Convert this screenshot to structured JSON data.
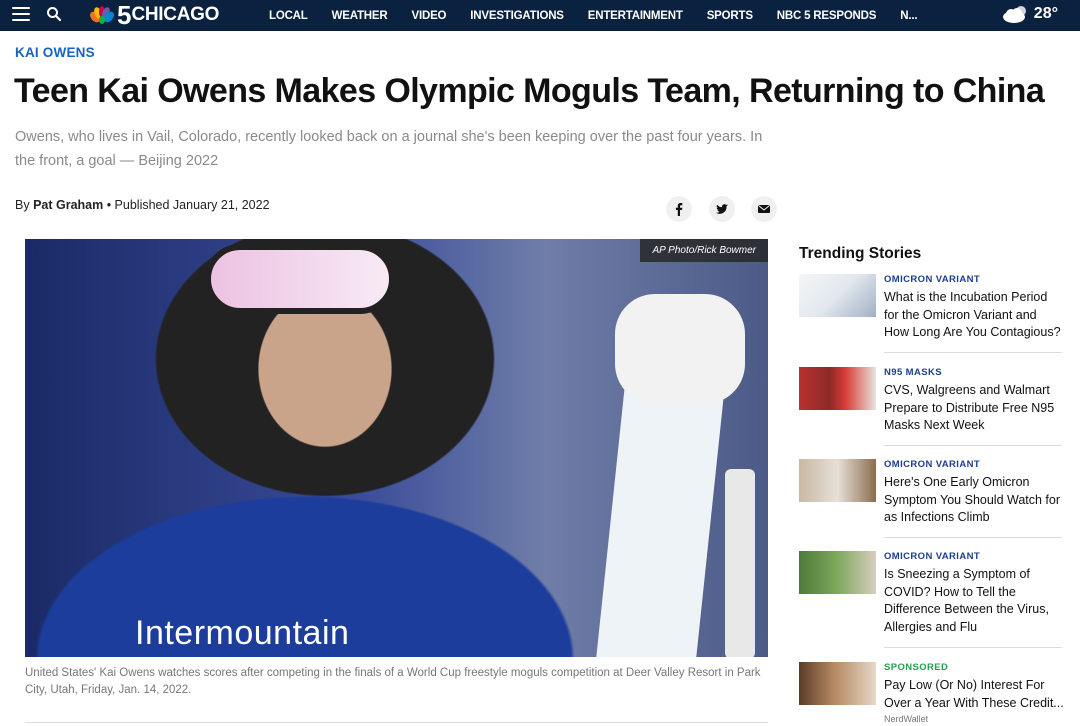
{
  "nav": {
    "logo_number": "5",
    "logo_city": "CHICAGO",
    "links": [
      "LOCAL",
      "WEATHER",
      "VIDEO",
      "INVESTIGATIONS",
      "ENTERTAINMENT",
      "SPORTS",
      "NBC 5 RESPONDS",
      "N..."
    ],
    "temperature": "28°",
    "weather_icon": "cloud-sun-icon"
  },
  "article": {
    "eyebrow": "KAI OWENS",
    "headline": "Teen Kai Owens Makes Olympic Moguls Team, Returning to China",
    "dek": "Owens, who lives in Vail, Colorado, recently looked back on a journal she's been keeping over the past four years. In the front, a goal — Beijing 2022",
    "byline_prefix": "By ",
    "author": "Pat Graham",
    "published": " • Published January 21, 2022",
    "share": [
      "facebook-icon",
      "twitter-icon",
      "email-icon"
    ]
  },
  "hero": {
    "credit": "AP Photo/Rick Bowmer",
    "sponsor_text": "Intermountain",
    "caption": "United States' Kai Owens watches scores after competing in the finals of a World Cup freestyle moguls competition at Deer Valley Resort in Park City, Utah, Friday, Jan. 14, 2022."
  },
  "sidebar": {
    "title": "Trending Stories",
    "stories": [
      {
        "tag": "OMICRON VARIANT",
        "title": "What is the Incubation Period for the Omicron Variant and How Long Are You Contagious?"
      },
      {
        "tag": "N95 MASKS",
        "title": "CVS, Walgreens and Walmart Prepare to Distribute Free N95 Masks Next Week"
      },
      {
        "tag": "OMICRON VARIANT",
        "title": "Here's One Early Omicron Symptom You Should Watch for as Infections Climb"
      },
      {
        "tag": "OMICRON VARIANT",
        "title": "Is Sneezing a Symptom of COVID? How to Tell the Difference Between the Virus, Allergies and Flu"
      },
      {
        "tag": "SPONSORED",
        "title": "Pay Low (Or No) Interest For Over a Year With These Credit...",
        "brand": "NerdWallet"
      }
    ]
  },
  "colors": {
    "nav_bg": "#0a2240",
    "eyebrow": "#1664c0",
    "tag": "#1e3f8f",
    "sponsored": "#23a050"
  }
}
